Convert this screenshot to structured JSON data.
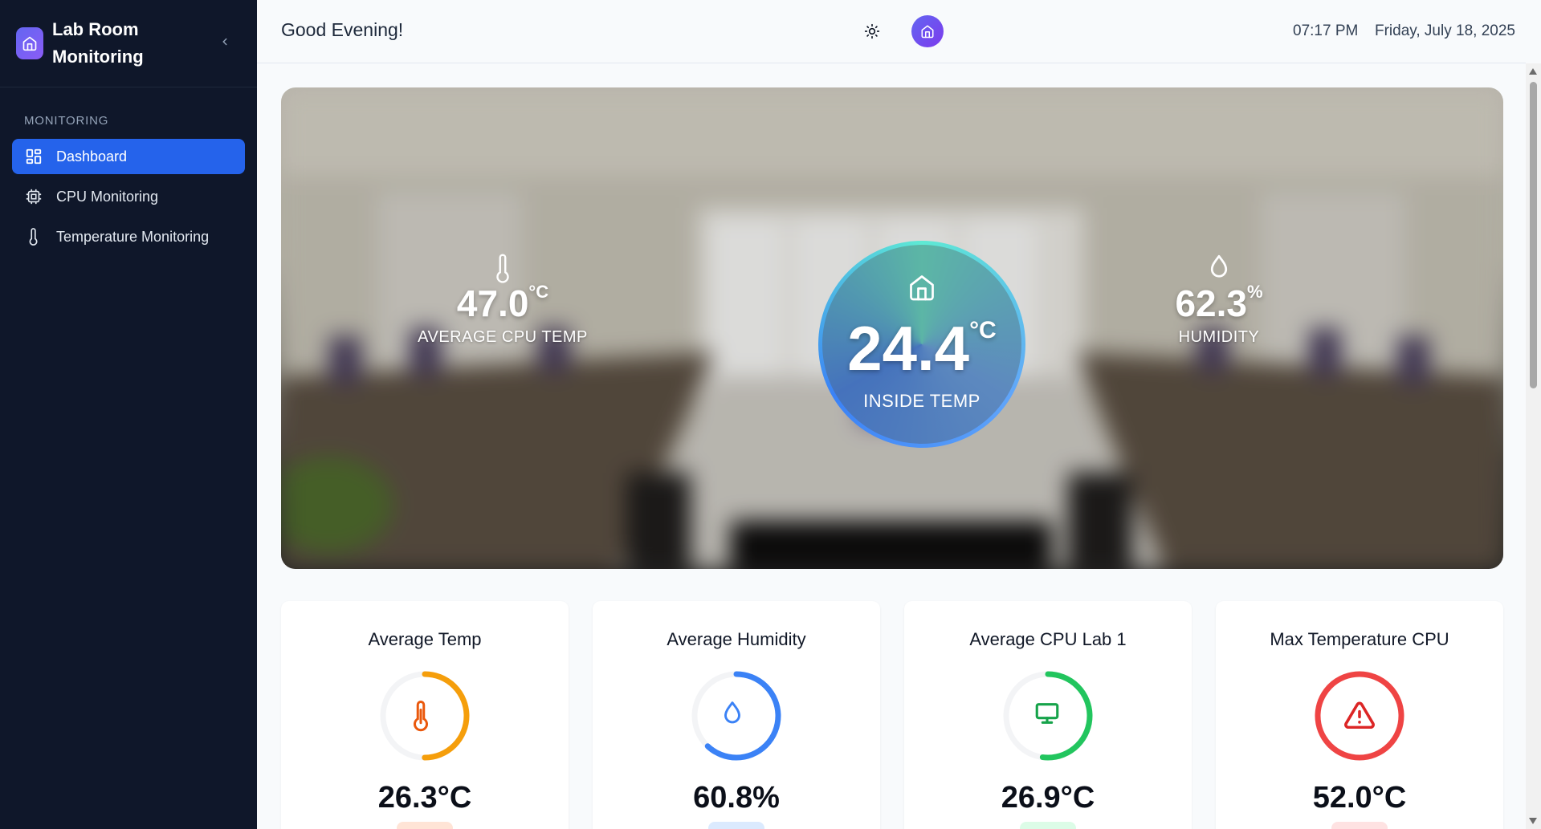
{
  "sidebar": {
    "brand_line1": "Lab Room",
    "brand_line2": "Monitoring",
    "section": "MONITORING",
    "items": [
      {
        "label": "Dashboard",
        "icon": "dashboard-grid-icon",
        "active": true
      },
      {
        "label": "CPU Monitoring",
        "icon": "cpu-chip-icon",
        "active": false
      },
      {
        "label": "Temperature Monitoring",
        "icon": "thermometer-icon",
        "active": false
      }
    ]
  },
  "header": {
    "greeting": "Good Evening!",
    "time": "07:17 PM",
    "date": "Friday, July 18, 2025"
  },
  "hero": {
    "cpu_temp": {
      "value": "47.0",
      "unit": "°C",
      "label": "AVERAGE CPU TEMP"
    },
    "inside_temp": {
      "value": "24.4",
      "unit": "°C",
      "label": "INSIDE TEMP"
    },
    "humidity": {
      "value": "62.3",
      "unit": "%",
      "label": "HUMIDITY"
    }
  },
  "cards": [
    {
      "title": "Average Temp",
      "value": "26.3°C",
      "icon": "thermometer-icon",
      "color": "#f59e0b",
      "icon_color": "#ea580c",
      "fill": 0.5,
      "pill": "#fee2e2"
    },
    {
      "title": "Average Humidity",
      "value": "60.8%",
      "icon": "droplet-icon",
      "color": "#3b82f6",
      "icon_color": "#3b82f6",
      "fill": 0.62,
      "pill": "#dbeafe"
    },
    {
      "title": "Average CPU Lab 1",
      "value": "26.9°C",
      "icon": "monitor-icon",
      "color": "#22c55e",
      "icon_color": "#16a34a",
      "fill": 0.52,
      "pill": "#dcfce7"
    },
    {
      "title": "Max Temperature CPU",
      "value": "52.0°C",
      "icon": "alert-triangle-icon",
      "color": "#ef4444",
      "icon_color": "#dc2626",
      "fill": 1.0,
      "pill": "#fee2e2"
    }
  ]
}
